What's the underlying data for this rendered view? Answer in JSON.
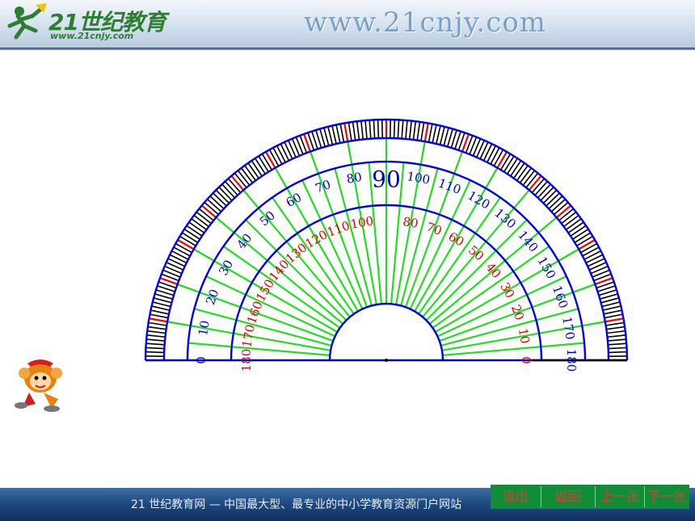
{
  "header": {
    "logo_text": "21世纪教育",
    "logo_url": "www.21cnjy.com",
    "site_url": "www.21cnjy.com"
  },
  "protractor": {
    "outer_labels": [
      "0",
      "10",
      "20",
      "30",
      "40",
      "50",
      "60",
      "70",
      "80",
      "90",
      "100",
      "110",
      "120",
      "130",
      "140",
      "150",
      "160",
      "170",
      "180"
    ],
    "inner_labels": [
      "180",
      "170",
      "160",
      "150",
      "140",
      "130",
      "120",
      "110",
      "100",
      "80",
      "70",
      "60",
      "50",
      "40",
      "30",
      "20",
      "10",
      "0"
    ],
    "colors": {
      "outer_label": "#0000cc",
      "inner_label": "#dd0000",
      "arc": "#0000ee",
      "ray": "#22dd22",
      "tick_ten": "#ff0000",
      "tick_degree": "#000000"
    }
  },
  "footer": {
    "text": "21 世纪教育网  —  中国最大型、最专业的中小学教育资源门户网站"
  },
  "nav": {
    "exit": "退出",
    "back": "返回",
    "prev": "上一张",
    "next": "下一张"
  }
}
